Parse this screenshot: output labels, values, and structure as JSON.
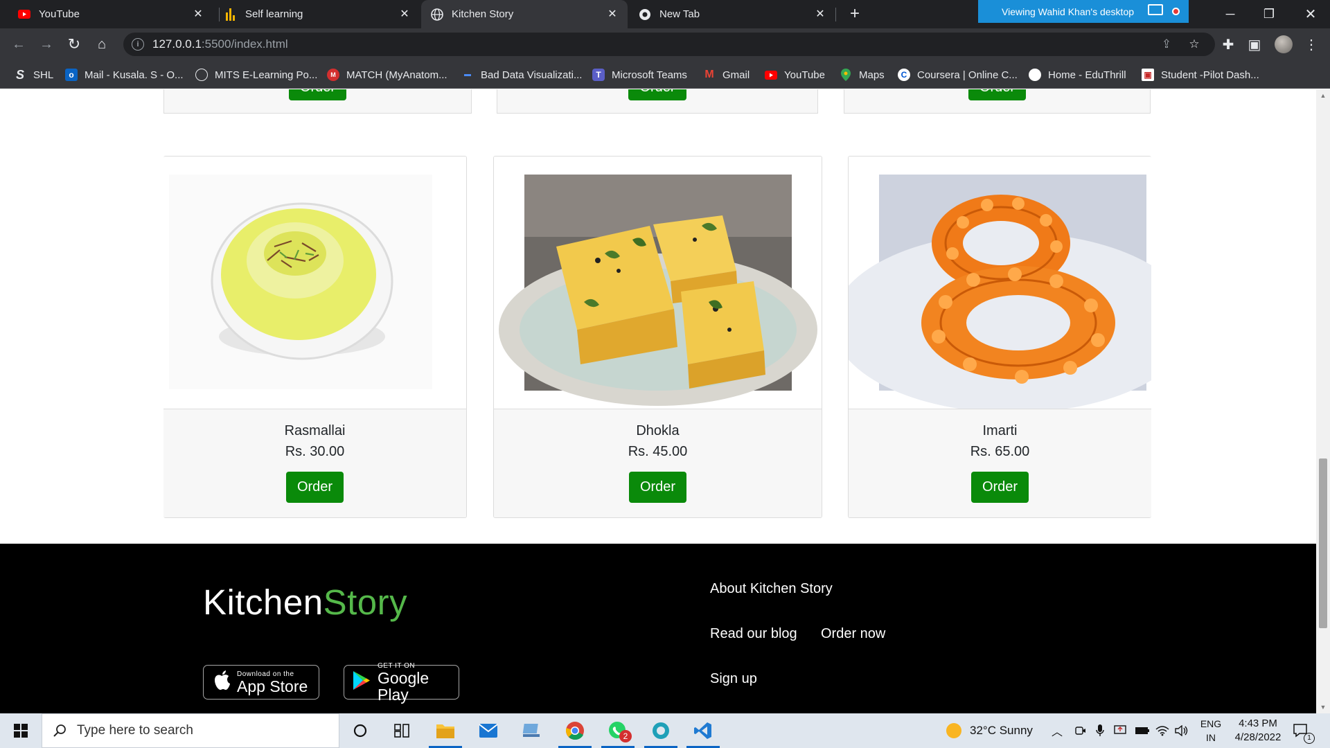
{
  "browser": {
    "tabs": [
      {
        "title": "YouTube",
        "icon": "youtube-icon"
      },
      {
        "title": "Self learning",
        "icon": "bar-chart-icon"
      },
      {
        "title": "Kitchen Story",
        "icon": "globe-icon",
        "active": true
      },
      {
        "title": "New Tab",
        "icon": "chrome-icon"
      }
    ],
    "new_tab_label": "+",
    "share_banner": "Viewing Wahid Khan's desktop",
    "url": {
      "host": "127.0.0.1",
      "rest": ":5500/index.html"
    }
  },
  "bookmarks": [
    {
      "label": "SHL",
      "icon": "shl-icon"
    },
    {
      "label": "Mail - Kusala. S - O...",
      "icon": "outlook-icon"
    },
    {
      "label": "MITS E-Learning Po...",
      "icon": "globe-icon"
    },
    {
      "label": "MATCH (MyAnatom...",
      "icon": "match-icon"
    },
    {
      "label": "Bad Data Visualizati...",
      "icon": "dash-icon"
    },
    {
      "label": "Microsoft Teams",
      "icon": "teams-icon"
    },
    {
      "label": "Gmail",
      "icon": "gmail-icon"
    },
    {
      "label": "YouTube",
      "icon": "youtube-icon"
    },
    {
      "label": "Maps",
      "icon": "maps-icon"
    },
    {
      "label": "Coursera | Online C...",
      "icon": "coursera-icon"
    },
    {
      "label": "Home - EduThrill",
      "icon": "eduthrill-icon"
    },
    {
      "label": "Student -Pilot Dash...",
      "icon": "student-icon"
    }
  ],
  "products_top_row": [
    {
      "order_label": "Order"
    },
    {
      "order_label": "Order"
    },
    {
      "order_label": "Order"
    }
  ],
  "products": [
    {
      "name": "Rasmallai",
      "price": "Rs. 30.00",
      "order_label": "Order"
    },
    {
      "name": "Dhokla",
      "price": "Rs. 45.00",
      "order_label": "Order"
    },
    {
      "name": "Imarti",
      "price": "Rs. 65.00",
      "order_label": "Order"
    }
  ],
  "footer": {
    "logo_part1": "Kitchen",
    "logo_part2": "Story",
    "app_store": {
      "small": "Download on the",
      "big": "App Store"
    },
    "google_play": {
      "small": "GET IT ON",
      "big": "Google Play"
    },
    "links": {
      "about": "About Kitchen Story",
      "blog": "Read our blog",
      "order": "Order now",
      "signup": "Sign up"
    }
  },
  "taskbar": {
    "search_placeholder": "Type here to search",
    "weather": "32°C  Sunny",
    "lang_line1": "ENG",
    "lang_line2": "IN",
    "time": "4:43 PM",
    "date": "4/28/2022",
    "whatsapp_badge": "2",
    "notification_count": "1"
  },
  "colors": {
    "brand_green": "#55b84a",
    "order_button": "#0a8a0a",
    "share_banner": "#1a8fd8"
  }
}
